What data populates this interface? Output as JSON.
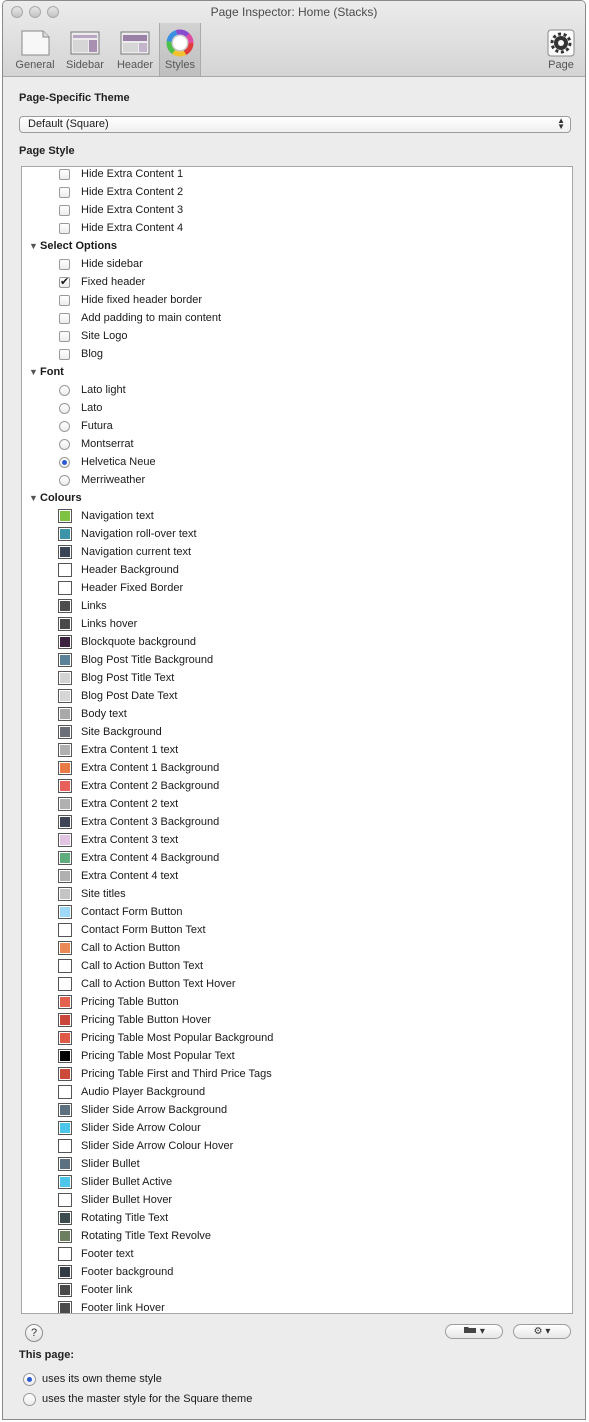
{
  "window": {
    "title": "Page Inspector: Home (Stacks)"
  },
  "toolbar": {
    "tabs": [
      {
        "label": "General",
        "icon": "document-icon"
      },
      {
        "label": "Sidebar",
        "icon": "sidebar-layout-icon"
      },
      {
        "label": "Header",
        "icon": "header-layout-icon"
      },
      {
        "label": "Styles",
        "icon": "color-wheel-icon",
        "selected": true
      }
    ],
    "page_label": "Page",
    "page_icon": "gear-icon"
  },
  "theme": {
    "label": "Page-Specific Theme",
    "value": "Default (Square)"
  },
  "page_style": {
    "label": "Page Style",
    "rows": [
      {
        "kind": "checkbox",
        "label": "Hide Extra Content 1",
        "checked": false
      },
      {
        "kind": "checkbox",
        "label": "Hide Extra Content 2",
        "checked": false
      },
      {
        "kind": "checkbox",
        "label": "Hide Extra Content 3",
        "checked": false
      },
      {
        "kind": "checkbox",
        "label": "Hide Extra Content 4",
        "checked": false
      },
      {
        "kind": "group",
        "label": "Select Options"
      },
      {
        "kind": "checkbox",
        "label": "Hide sidebar",
        "checked": false
      },
      {
        "kind": "checkbox",
        "label": "Fixed header",
        "checked": true
      },
      {
        "kind": "checkbox",
        "label": "Hide fixed header border",
        "checked": false
      },
      {
        "kind": "checkbox",
        "label": "Add padding to main content",
        "checked": false
      },
      {
        "kind": "checkbox",
        "label": "Site Logo",
        "checked": false
      },
      {
        "kind": "checkbox",
        "label": "Blog",
        "checked": false
      },
      {
        "kind": "group",
        "label": "Font"
      },
      {
        "kind": "radio",
        "label": "Lato light",
        "checked": false
      },
      {
        "kind": "radio",
        "label": "Lato",
        "checked": false
      },
      {
        "kind": "radio",
        "label": "Futura",
        "checked": false
      },
      {
        "kind": "radio",
        "label": "Montserrat",
        "checked": false
      },
      {
        "kind": "radio",
        "label": "Helvetica Neue",
        "checked": true
      },
      {
        "kind": "radio",
        "label": "Merriweather",
        "checked": false
      },
      {
        "kind": "group",
        "label": "Colours"
      },
      {
        "kind": "color",
        "label": "Navigation text",
        "color": "#7dc242"
      },
      {
        "kind": "color",
        "label": "Navigation roll-over text",
        "color": "#3d93aa"
      },
      {
        "kind": "color",
        "label": "Navigation current text",
        "color": "#3c4555"
      },
      {
        "kind": "color",
        "label": "Header Background",
        "color": "#ffffff"
      },
      {
        "kind": "color",
        "label": "Header Fixed Border",
        "color": "#ffffff"
      },
      {
        "kind": "color",
        "label": "Links",
        "color": "#4d4d4d"
      },
      {
        "kind": "color",
        "label": "Links hover",
        "color": "#4a4a4a"
      },
      {
        "kind": "color",
        "label": "Blockquote background",
        "color": "#3b2040"
      },
      {
        "kind": "color",
        "label": "Blog Post Title Background",
        "color": "#5b8299"
      },
      {
        "kind": "color",
        "label": "Blog Post Title Text",
        "color": "#d3d3d3"
      },
      {
        "kind": "color",
        "label": "Blog Post Date Text",
        "color": "#d6d6d6"
      },
      {
        "kind": "color",
        "label": "Body text",
        "color": "#a9a9a9"
      },
      {
        "kind": "color",
        "label": "Site Background",
        "color": "#6c6f78"
      },
      {
        "kind": "color",
        "label": "Extra Content 1 text",
        "color": "#b0b0b0"
      },
      {
        "kind": "color",
        "label": "Extra Content 1 Background",
        "color": "#ea7a48"
      },
      {
        "kind": "color",
        "label": "Extra Content 2 Background",
        "color": "#e9605a"
      },
      {
        "kind": "color",
        "label": "Extra Content 2 text",
        "color": "#b0b0b0"
      },
      {
        "kind": "color",
        "label": "Extra Content 3 Background",
        "color": "#3d4556"
      },
      {
        "kind": "color",
        "label": "Extra Content 3 text",
        "color": "#e2c4e4"
      },
      {
        "kind": "color",
        "label": "Extra Content 4 Background",
        "color": "#5fac7c"
      },
      {
        "kind": "color",
        "label": "Extra Content 4 text",
        "color": "#b0b0b0"
      },
      {
        "kind": "color",
        "label": "Site titles",
        "color": "#c4c4c4"
      },
      {
        "kind": "color",
        "label": "Contact Form Button",
        "color": "#9fd8f8"
      },
      {
        "kind": "color",
        "label": "Contact Form Button Text",
        "color": "#ffffff"
      },
      {
        "kind": "color",
        "label": "Call to Action Button",
        "color": "#ea8a58"
      },
      {
        "kind": "color",
        "label": "Call to Action Button Text",
        "color": "#ffffff"
      },
      {
        "kind": "color",
        "label": "Call to Action Button Text Hover",
        "color": "#ffffff"
      },
      {
        "kind": "color",
        "label": "Pricing Table Button",
        "color": "#e2624f"
      },
      {
        "kind": "color",
        "label": "Pricing Table Button Hover",
        "color": "#c8463a"
      },
      {
        "kind": "color",
        "label": "Pricing Table Most Popular Background",
        "color": "#e05a48"
      },
      {
        "kind": "color",
        "label": "Pricing Table Most Popular Text",
        "color": "#000000"
      },
      {
        "kind": "color",
        "label": "Pricing Table First and Third Price Tags",
        "color": "#cc4a3a"
      },
      {
        "kind": "color",
        "label": "Audio Player Background",
        "color": "#ffffff"
      },
      {
        "kind": "color",
        "label": "Slider Side Arrow Background",
        "color": "#5c7080"
      },
      {
        "kind": "color",
        "label": "Slider Side Arrow Colour",
        "color": "#4ec6ea"
      },
      {
        "kind": "color",
        "label": "Slider Side Arrow Colour Hover",
        "color": "#ffffff"
      },
      {
        "kind": "color",
        "label": "Slider Bullet",
        "color": "#5c7080"
      },
      {
        "kind": "color",
        "label": "Slider Bullet Active",
        "color": "#4ec6ea"
      },
      {
        "kind": "color",
        "label": "Slider Bullet Hover",
        "color": "#ffffff"
      },
      {
        "kind": "color",
        "label": "Rotating Title Text",
        "color": "#3c4b50"
      },
      {
        "kind": "color",
        "label": "Rotating Title Text Revolve",
        "color": "#6b7f60"
      },
      {
        "kind": "color",
        "label": "Footer text",
        "color": "#ffffff"
      },
      {
        "kind": "color",
        "label": "Footer background",
        "color": "#333c45"
      },
      {
        "kind": "color",
        "label": "Footer link",
        "color": "#4a4a4a"
      },
      {
        "kind": "color",
        "label": "Footer link Hover",
        "color": "#4a4a4a"
      }
    ]
  },
  "bottom_bar": {
    "help_label": "?",
    "folder_icon": "folder-icon",
    "action_icon": "gear-icon"
  },
  "this_page": {
    "label": "This page:",
    "options": [
      {
        "label": "uses its own theme style",
        "selected": true
      },
      {
        "label": "uses the master style for the Square theme",
        "selected": false
      }
    ]
  }
}
